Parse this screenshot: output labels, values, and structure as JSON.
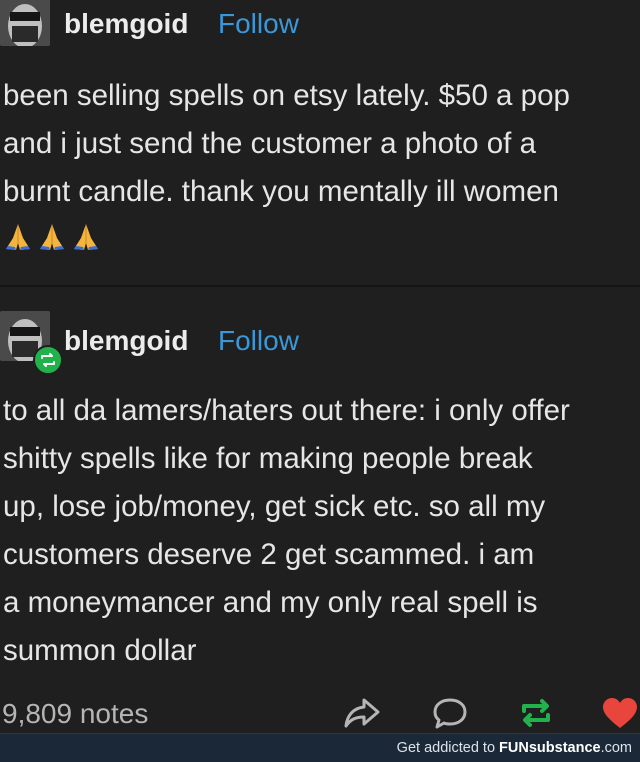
{
  "posts": [
    {
      "username": "blemgoid",
      "follow_label": "Follow",
      "body": "been selling spells on etsy lately. $50 a pop\nand i just send the customer a photo of a\nburnt candle. thank you mentally ill women",
      "emoji_icons": [
        "folded-hands-emoji",
        "folded-hands-emoji",
        "folded-hands-emoji"
      ]
    },
    {
      "username": "blemgoid",
      "follow_label": "Follow",
      "body": "to all da lamers/haters out there: i only offer\nshitty spells like for making people break\nup, lose job/money, get sick etc. so all my\ncustomers deserve 2 get scammed. i am\na moneymancer and my only real spell is\nsummon dollar"
    }
  ],
  "footer": {
    "notes": "9,809 notes",
    "icons": [
      "share-icon",
      "reply-icon",
      "reblog-icon",
      "like-icon"
    ]
  },
  "watermark": {
    "prefix": "Get addicted to ",
    "brand": "FUNsubstance",
    "suffix": ".com"
  },
  "colors": {
    "background": "#1f1f1f",
    "follow": "#3b98d8",
    "reblog_green": "#22b24c",
    "like_red": "#e8453c"
  }
}
